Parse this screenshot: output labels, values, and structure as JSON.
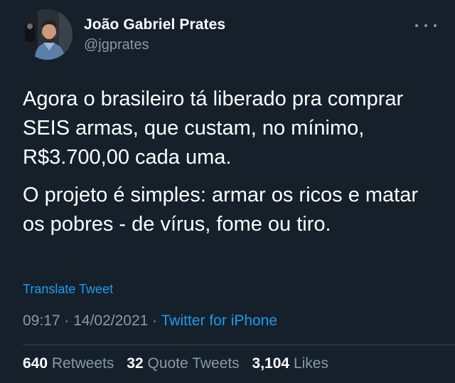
{
  "author": {
    "display_name": "João Gabriel Prates",
    "handle": "@jgprates",
    "avatar_icon": "profile-photo"
  },
  "more_icon": "more-horizontal-icon",
  "tweet": {
    "paragraphs": [
      "Agora o brasileiro tá liberado pra comprar SEIS armas, que custam, no mínimo, R$3.700,00 cada uma.",
      "O projeto é simples: armar os ricos e matar os pobres - de vírus, fome ou tiro."
    ],
    "translate_label": "Translate Tweet",
    "time": "09:17",
    "separator": " · ",
    "date": "14/02/2021",
    "source": "Twitter for iPhone"
  },
  "stats": {
    "retweets_count": "640",
    "retweets_label": "Retweets",
    "quote_count": "32",
    "quote_label": "Quote Tweets",
    "likes_count": "3,104",
    "likes_label": "Likes"
  },
  "colors": {
    "background": "#15202b",
    "text_primary": "#ffffff",
    "text_secondary": "#8b98a5",
    "link": "#1d9bf0",
    "divider": "#38444d"
  }
}
